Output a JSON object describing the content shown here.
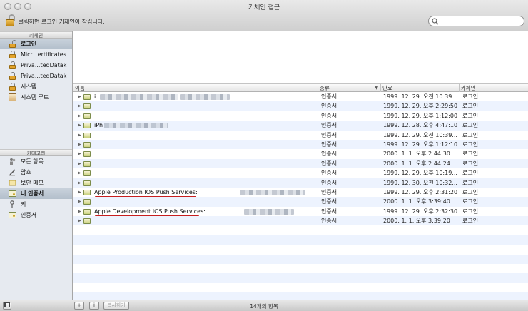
{
  "window": {
    "title": "키체인 접근"
  },
  "toolbar": {
    "lock_text": "클릭하면 로그인 키체인이 잠깁니다.",
    "search_placeholder": ""
  },
  "sidebar": {
    "keychains_header": "키체인",
    "keychains": [
      {
        "label": "로그인",
        "selected": true,
        "icon": "lock-open-icon"
      },
      {
        "label": "Micr...ertificates",
        "selected": false,
        "icon": "lock-icon"
      },
      {
        "label": "Priva...tedDatak",
        "selected": false,
        "icon": "lock-icon"
      },
      {
        "label": "Priva...tedDatak",
        "selected": false,
        "icon": "lock-icon"
      },
      {
        "label": "시스템",
        "selected": false,
        "icon": "lock-icon"
      },
      {
        "label": "시스템 루트",
        "selected": false,
        "icon": "keychain-file-icon"
      }
    ],
    "categories_header": "카테고리",
    "categories": [
      {
        "label": "모든 항목",
        "selected": false,
        "icon": "people-icon"
      },
      {
        "label": "암호",
        "selected": false,
        "icon": "pen-icon"
      },
      {
        "label": "보안 메모",
        "selected": false,
        "icon": "note-icon"
      },
      {
        "label": "내 인증서",
        "selected": true,
        "icon": "certificate-icon"
      },
      {
        "label": "키",
        "selected": false,
        "icon": "key-icon"
      },
      {
        "label": "인증서",
        "selected": false,
        "icon": "certificate-icon"
      }
    ]
  },
  "table": {
    "columns": {
      "name": "이름",
      "kind": "종류",
      "expires": "만료",
      "keychain": "키체인"
    },
    "rows": [
      {
        "name": "i",
        "kind": "인증서",
        "expires": "1999. 12. 29. 오전 10:39...",
        "keychain": "로그인"
      },
      {
        "name": "",
        "kind": "인증서",
        "expires": "1999. 12. 29. 오후 2:29:50",
        "keychain": "로그인"
      },
      {
        "name": "",
        "kind": "인증서",
        "expires": "1999. 12. 29. 오후 1:12:00",
        "keychain": "로그인"
      },
      {
        "name": "iPh",
        "kind": "인증서",
        "expires": "1999. 12. 28. 오후 4:47:10",
        "keychain": "로그인"
      },
      {
        "name": "",
        "kind": "인증서",
        "expires": "1999. 12. 29. 오전 10:39...",
        "keychain": "로그인"
      },
      {
        "name": "",
        "kind": "인증서",
        "expires": "1999. 12. 29. 오후 1:12:10",
        "keychain": "로그인"
      },
      {
        "name": "",
        "kind": "인증서",
        "expires": "2000. 1. 1. 오후 2:44:30",
        "keychain": "로그인"
      },
      {
        "name": "",
        "kind": "인증서",
        "expires": "2000. 1. 1. 오후 2:44:24",
        "keychain": "로그인"
      },
      {
        "name": "",
        "kind": "인증서",
        "expires": "1999. 12. 29. 오후 10:19...",
        "keychain": "로그인"
      },
      {
        "name": "",
        "kind": "인증서",
        "expires": "1999. 12. 30. 오전 10:32...",
        "keychain": "로그인"
      },
      {
        "name": "Apple Production IOS Push Services:",
        "kind": "인증서",
        "expires": "1999. 12. 29. 오후 2:31:20",
        "keychain": "로그인"
      },
      {
        "name": "",
        "kind": "인증서",
        "expires": "2000. 1. 1. 오후 3:39:40",
        "keychain": "로그인"
      },
      {
        "name": "Apple Development IOS Push Services:",
        "kind": "인증서",
        "expires": "1999. 12. 29. 오후 2:32:30",
        "keychain": "로그인"
      },
      {
        "name": "",
        "kind": "인증서",
        "expires": "2000. 1. 1. 오후 3:39:20",
        "keychain": "로그인"
      }
    ]
  },
  "bottom": {
    "add_label": "+",
    "info_label": "i",
    "copy_label": "복사하기",
    "status": "14개의 항목"
  }
}
